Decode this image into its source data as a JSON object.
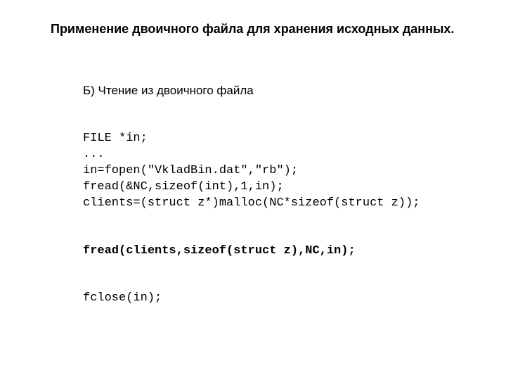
{
  "title": "Применение двоичного файла для хранения исходных данных.",
  "subhead": "Б) Чтение из двоичного файла",
  "code": {
    "l1": "FILE *in;",
    "l2": "...",
    "l3": "in=fopen(\"VkladBin.dat\",\"rb\");",
    "l4": "fread(&NC,sizeof(int),1,in);",
    "l5": "clients=(struct z*)malloc(NC*sizeof(struct z));",
    "l6": "fread(clients,sizeof(struct z),NC,in);",
    "l7": "fclose(in);"
  }
}
